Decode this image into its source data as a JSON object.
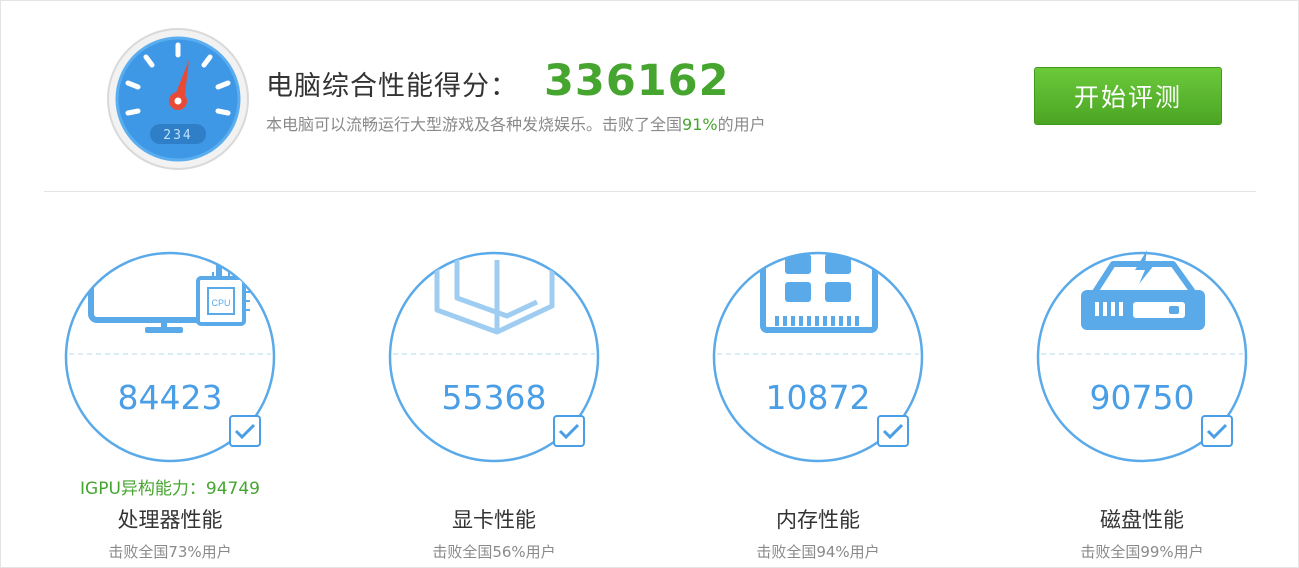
{
  "header": {
    "gauge_display": "234",
    "title": "电脑综合性能得分：",
    "score": "336162",
    "subtitle_prefix": "本电脑可以流畅运行大型游戏及各种发烧娱乐。击败了全国",
    "subtitle_percent": "91%",
    "subtitle_suffix": "的用户",
    "start_button": "开始评测"
  },
  "cards": [
    {
      "score": "84423",
      "label": "处理器性能",
      "beat": "击败全国73%用户",
      "extra": "IGPU异构能力：94749",
      "chip_label": "CPU",
      "icon": "monitor-cpu-icon",
      "checked": true
    },
    {
      "score": "55368",
      "label": "显卡性能",
      "beat": "击败全国56%用户",
      "icon": "cube-icon",
      "checked": true
    },
    {
      "score": "10872",
      "label": "内存性能",
      "beat": "击败全国94%用户",
      "icon": "memory-icon",
      "checked": true
    },
    {
      "score": "90750",
      "label": "磁盘性能",
      "beat": "击败全国99%用户",
      "icon": "disk-icon",
      "checked": true
    }
  ],
  "colors": {
    "accent_green": "#45a52e",
    "accent_blue": "#4a9ee6",
    "button_green": "#5bb92f"
  }
}
